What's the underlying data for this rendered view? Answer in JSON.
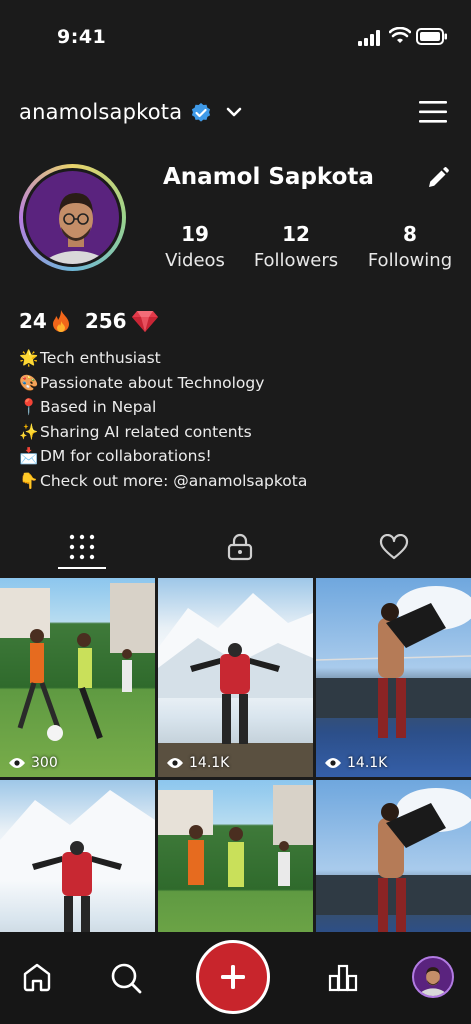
{
  "status_bar": {
    "time": "9:41"
  },
  "header": {
    "username": "anamolsapkota"
  },
  "profile": {
    "full_name": "Anamol Sapkota",
    "stats": [
      {
        "value": "19",
        "label": "Videos"
      },
      {
        "value": "12",
        "label": "Followers"
      },
      {
        "value": "8",
        "label": "Following"
      }
    ],
    "streak": "24",
    "gems": "256",
    "bio": [
      {
        "emoji": "🌟",
        "text": "Tech enthusiast"
      },
      {
        "emoji": "🎨",
        "text": "Passionate about Technology"
      },
      {
        "emoji": "📍",
        "text": "Based in Nepal"
      },
      {
        "emoji": "✨",
        "text": "Sharing AI related contents"
      },
      {
        "emoji": "📩",
        "text": "DM for collaborations!"
      },
      {
        "emoji": "👇",
        "text": "Check out more: @anamolsapkota"
      }
    ]
  },
  "tabs": [
    {
      "icon": "grid-icon",
      "active": true
    },
    {
      "icon": "lock-icon",
      "active": false
    },
    {
      "icon": "heart-icon",
      "active": false
    }
  ],
  "videos": [
    {
      "views": "300"
    },
    {
      "views": "14.1K"
    },
    {
      "views": "14.1K"
    },
    {
      "views": ""
    },
    {
      "views": ""
    },
    {
      "views": ""
    }
  ],
  "colors": {
    "background": "#1b1b1b",
    "accent": "#c8252c",
    "verified": "#3f9ae8"
  }
}
